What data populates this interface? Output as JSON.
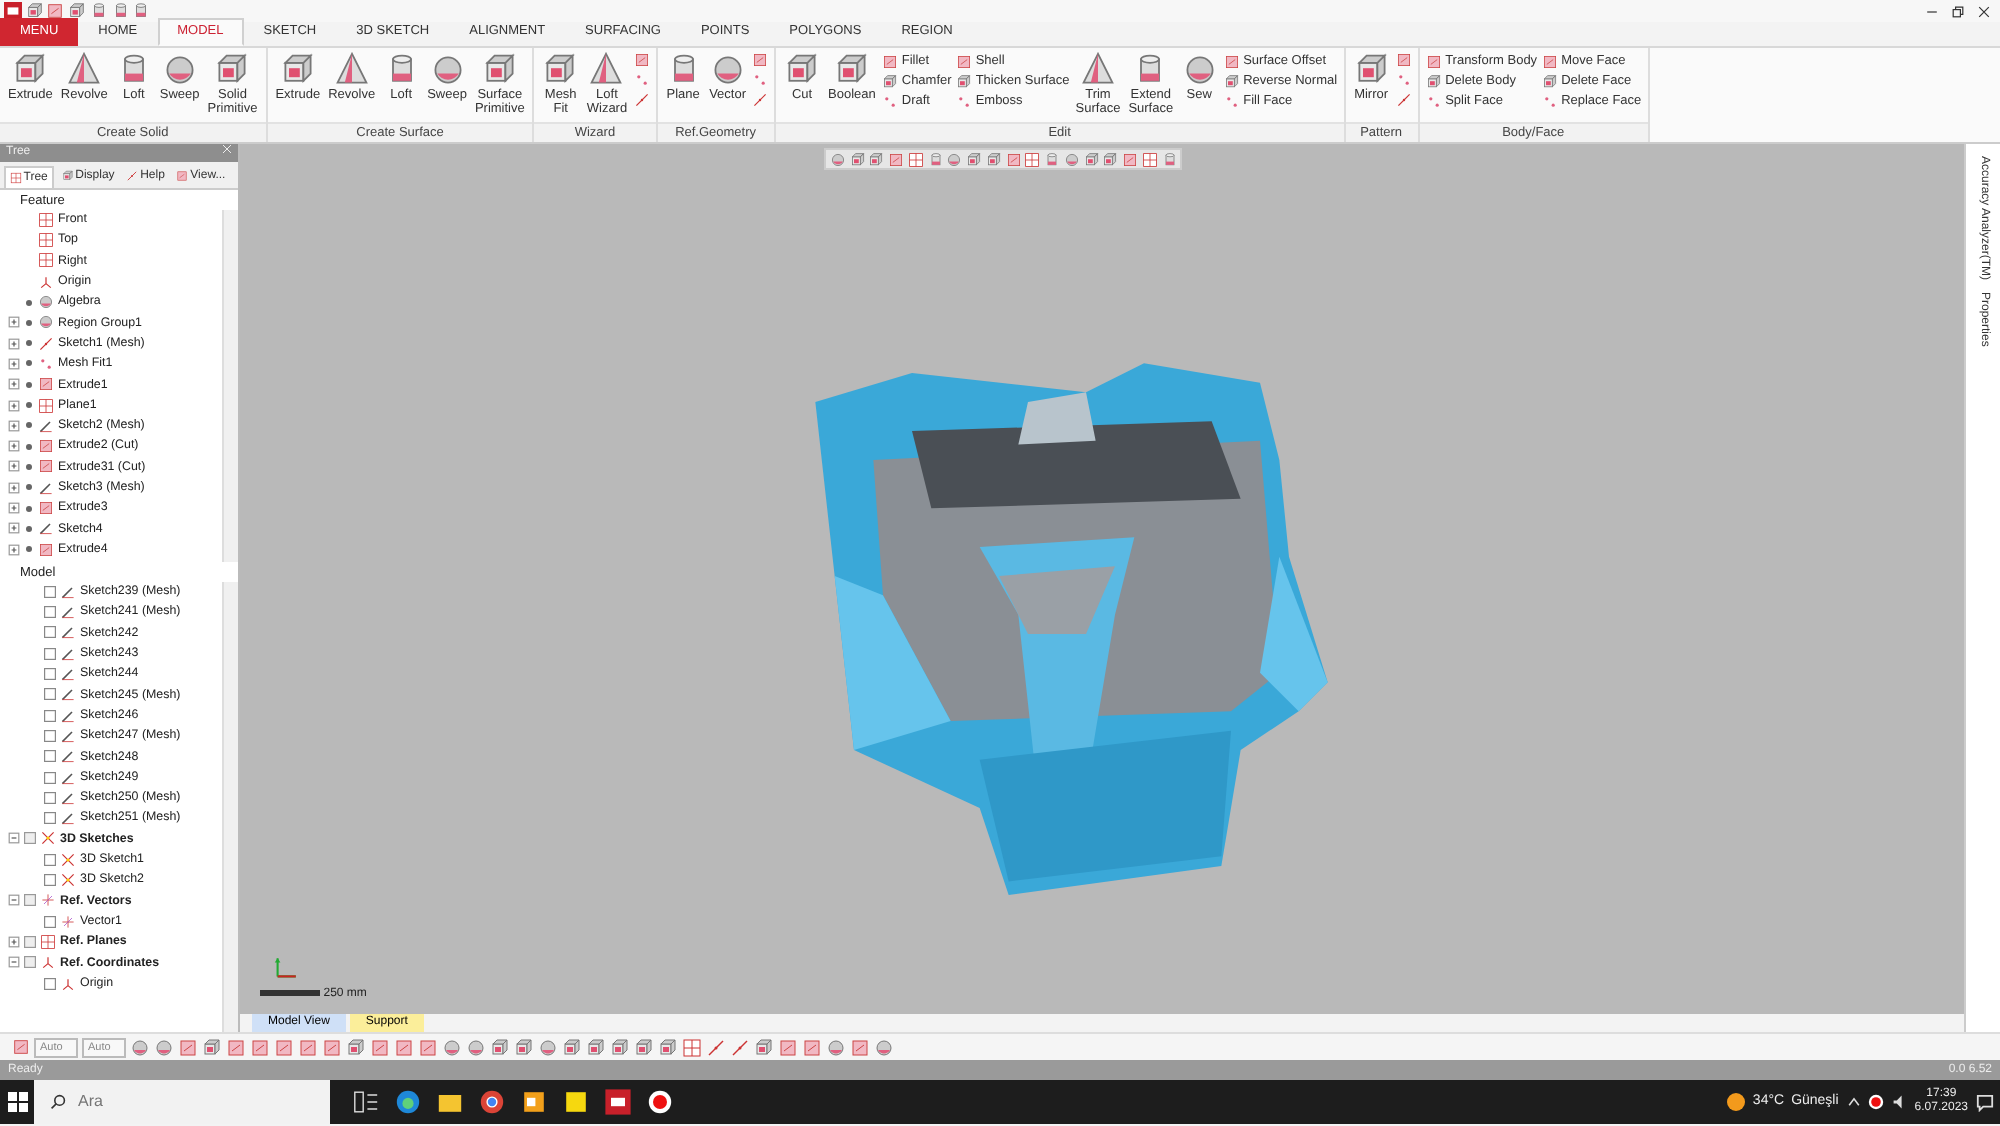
{
  "tabs": [
    {
      "label": "MENU",
      "kind": "menu",
      "selected": false
    },
    {
      "label": "HOME",
      "kind": "tab",
      "selected": false
    },
    {
      "label": "MODEL",
      "kind": "tab",
      "selected": true
    },
    {
      "label": "SKETCH",
      "kind": "tab",
      "selected": false
    },
    {
      "label": "3D SKETCH",
      "kind": "tab",
      "selected": false
    },
    {
      "label": "ALIGNMENT",
      "kind": "tab",
      "selected": false
    },
    {
      "label": "SURFACING",
      "kind": "tab",
      "selected": false
    },
    {
      "label": "POINTS",
      "kind": "tab",
      "selected": false
    },
    {
      "label": "POLYGONS",
      "kind": "tab",
      "selected": false
    },
    {
      "label": "REGION",
      "kind": "tab",
      "selected": false
    }
  ],
  "ribbon_groups": [
    {
      "title": "Create Solid",
      "items": [
        {
          "kind": "large",
          "label": "Extrude"
        },
        {
          "kind": "large",
          "label": "Revolve"
        },
        {
          "kind": "large",
          "label": "Loft"
        },
        {
          "kind": "large",
          "label": "Sweep"
        },
        {
          "kind": "large",
          "label": "Solid Primitive"
        }
      ]
    },
    {
      "title": "Create Surface",
      "items": [
        {
          "kind": "large",
          "label": "Extrude"
        },
        {
          "kind": "large",
          "label": "Revolve"
        },
        {
          "kind": "large",
          "label": "Loft"
        },
        {
          "kind": "large",
          "label": "Sweep"
        },
        {
          "kind": "large",
          "label": "Surface Primitive"
        }
      ]
    },
    {
      "title": "Wizard",
      "items": [
        {
          "kind": "large",
          "label": "Mesh Fit"
        },
        {
          "kind": "large",
          "label": "Loft Wizard"
        },
        {
          "kind": "icons"
        }
      ]
    },
    {
      "title": "Ref.Geometry",
      "items": [
        {
          "kind": "large",
          "label": "Plane"
        },
        {
          "kind": "large",
          "label": "Vector"
        },
        {
          "kind": "icons"
        }
      ]
    },
    {
      "title": "Edit",
      "items": [
        {
          "kind": "large",
          "label": "Cut"
        },
        {
          "kind": "large",
          "label": "Boolean"
        },
        {
          "kind": "stack",
          "tools": [
            "Fillet",
            "Chamfer",
            "Draft"
          ]
        },
        {
          "kind": "stack",
          "tools": [
            "Shell",
            "Thicken Surface",
            "Emboss"
          ]
        },
        {
          "kind": "large",
          "label": "Trim Surface"
        },
        {
          "kind": "large",
          "label": "Extend Surface"
        },
        {
          "kind": "large",
          "label": "Sew"
        },
        {
          "kind": "stack",
          "tools": [
            "Surface Offset",
            "Reverse Normal",
            "Fill Face"
          ]
        }
      ]
    },
    {
      "title": "Pattern",
      "items": [
        {
          "kind": "large",
          "label": "Mirror"
        },
        {
          "kind": "icons"
        }
      ]
    },
    {
      "title": "Body/Face",
      "items": [
        {
          "kind": "stack",
          "tools": [
            "Transform Body",
            "Delete Body",
            "Split Face"
          ]
        },
        {
          "kind": "stack",
          "tools": [
            "Move Face",
            "Delete Face",
            "Replace Face"
          ]
        }
      ]
    }
  ],
  "tree_panel": {
    "title": "Tree",
    "tabs": [
      {
        "label": "Tree",
        "selected": true
      },
      {
        "label": "Display",
        "selected": false
      },
      {
        "label": "Help",
        "selected": false
      },
      {
        "label": "View...",
        "selected": false
      }
    ],
    "feature": {
      "title": "Feature",
      "items": [
        {
          "label": "Front",
          "kind": "plane",
          "visible": false
        },
        {
          "label": "Top",
          "kind": "plane",
          "visible": false
        },
        {
          "label": "Right",
          "kind": "plane",
          "visible": false
        },
        {
          "label": "Origin",
          "kind": "origin",
          "visible": false
        },
        {
          "label": "Algebra",
          "kind": "body",
          "visible": true
        },
        {
          "label": "Region Group1",
          "kind": "region",
          "visible": true,
          "expanded": false
        },
        {
          "label": "Sketch1 (Mesh)",
          "kind": "sketch-warning",
          "visible": true,
          "expanded": false
        },
        {
          "label": "Mesh Fit1",
          "kind": "mesh-fit",
          "visible": true,
          "expanded": false
        },
        {
          "label": "Extrude1",
          "kind": "extrude",
          "visible": true,
          "expanded": false
        },
        {
          "label": "Plane1",
          "kind": "plane",
          "visible": true,
          "expanded": false
        },
        {
          "label": "Sketch2 (Mesh)",
          "kind": "sketch",
          "visible": true,
          "expanded": false
        },
        {
          "label": "Extrude2 (Cut)",
          "kind": "extrude",
          "visible": true,
          "expanded": false
        },
        {
          "label": "Extrude31 (Cut)",
          "kind": "extrude",
          "visible": true,
          "expanded": false
        },
        {
          "label": "Sketch3 (Mesh)",
          "kind": "sketch",
          "visible": true,
          "expanded": false
        },
        {
          "label": "Extrude3",
          "kind": "extrude",
          "visible": true,
          "expanded": false
        },
        {
          "label": "Sketch4",
          "kind": "sketch",
          "visible": true,
          "expanded": false
        },
        {
          "label": "Extrude4",
          "kind": "extrude",
          "visible": true,
          "expanded": false
        }
      ]
    },
    "model": {
      "title": "Model",
      "continued_children": [
        {
          "label": "Sketch239 (Mesh)",
          "kind": "sketch",
          "checked": false
        },
        {
          "label": "Sketch241 (Mesh)",
          "kind": "sketch",
          "checked": false
        },
        {
          "label": "Sketch242",
          "kind": "sketch",
          "checked": false
        },
        {
          "label": "Sketch243",
          "kind": "sketch",
          "checked": false
        },
        {
          "label": "Sketch244",
          "kind": "sketch",
          "checked": false
        },
        {
          "label": "Sketch245 (Mesh)",
          "kind": "sketch",
          "checked": false
        },
        {
          "label": "Sketch246",
          "kind": "sketch",
          "checked": false
        },
        {
          "label": "Sketch247 (Mesh)",
          "kind": "sketch",
          "checked": false
        },
        {
          "label": "Sketch248",
          "kind": "sketch",
          "checked": false
        },
        {
          "label": "Sketch249",
          "kind": "sketch",
          "checked": false
        },
        {
          "label": "Sketch250 (Mesh)",
          "kind": "sketch",
          "checked": false
        },
        {
          "label": "Sketch251 (Mesh)",
          "kind": "sketch",
          "checked": false
        }
      ],
      "items": [
        {
          "label": "3D Sketches",
          "kind": "sketch3d",
          "expanded": true,
          "children": [
            {
              "label": "3D Sketch1",
              "kind": "sketch3d",
              "checked": false
            },
            {
              "label": "3D Sketch2",
              "kind": "sketch3d",
              "checked": false
            }
          ]
        },
        {
          "label": "Ref. Vectors",
          "kind": "vector",
          "expanded": true,
          "children": [
            {
              "label": "Vector1",
              "kind": "vector",
              "checked": false
            }
          ]
        },
        {
          "label": "Ref. Planes",
          "kind": "plane",
          "expanded": false
        },
        {
          "label": "Ref. Coordinates",
          "kind": "origin",
          "expanded": true,
          "children": [
            {
              "label": "Origin",
              "kind": "origin",
              "checked": false
            }
          ]
        }
      ]
    }
  },
  "viewport": {
    "scale_label": "250 mm",
    "side_tabs": [
      "Accuracy Analyzer(TM)",
      "Properties"
    ],
    "view_tabs": [
      {
        "label": "Model View",
        "color": "#cfe0f7"
      },
      {
        "label": "Support",
        "color": "#fbee9a"
      }
    ]
  },
  "toolbar": {
    "dropdowns": [
      "Auto",
      "Auto"
    ]
  },
  "status_bar": {
    "text": "Ready",
    "coords": "0.0 6.52"
  },
  "taskbar": {
    "search_placeholder": "Ara",
    "temperature": "34°C",
    "weather": "Güneşli",
    "time": "17:39",
    "date": "6.07.2023"
  }
}
